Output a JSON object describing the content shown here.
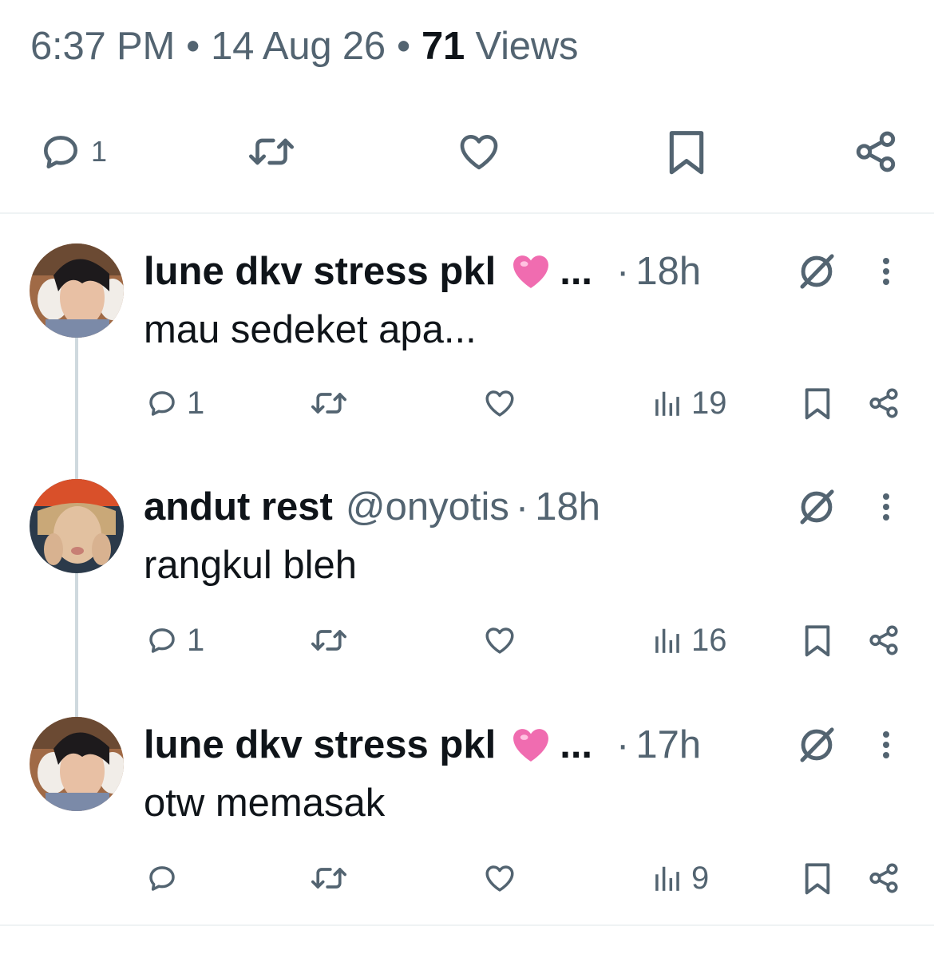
{
  "tweet_meta": {
    "time": "6:37 PM",
    "separator": "•",
    "date": "14 Aug 26",
    "views_count": "71",
    "views_label": "Views"
  },
  "main_actions": {
    "reply_count": "1"
  },
  "replies": [
    {
      "name": "lune dkv stress pkl",
      "emoji": "pink-heart",
      "truncated": "...",
      "handle": "",
      "separator": "·",
      "time": "18h",
      "text": "mau sedeket apa...",
      "reply_count": "1",
      "views": "19"
    },
    {
      "name": "andut rest",
      "emoji": "",
      "truncated": "",
      "handle": "@onyotis",
      "separator": "·",
      "time": "18h",
      "text": "rangkul bleh",
      "reply_count": "1",
      "views": "16"
    },
    {
      "name": "lune dkv stress pkl",
      "emoji": "pink-heart",
      "truncated": "...",
      "handle": "",
      "separator": "·",
      "time": "17h",
      "text": "otw memasak",
      "reply_count": "",
      "views": "9"
    }
  ],
  "colors": {
    "text_primary": "#0f1419",
    "text_secondary": "#536471",
    "divider": "#eff3f4",
    "thread_line": "#cfd9de",
    "heart_emoji": "#f06cb0"
  }
}
